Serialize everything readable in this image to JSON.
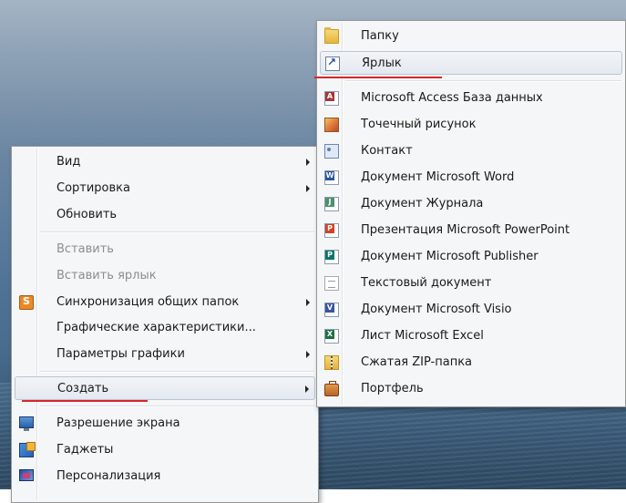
{
  "main_menu": {
    "items": [
      {
        "label": "Вид",
        "has_submenu": true,
        "disabled": false
      },
      {
        "label": "Сортировка",
        "has_submenu": true,
        "disabled": false
      },
      {
        "label": "Обновить",
        "has_submenu": false,
        "disabled": false
      },
      {
        "label": "Вставить",
        "has_submenu": false,
        "disabled": true
      },
      {
        "label": "Вставить ярлык",
        "has_submenu": false,
        "disabled": true
      },
      {
        "label": "Синхронизация общих папок",
        "has_submenu": true,
        "disabled": false,
        "icon": "sync-icon"
      },
      {
        "label": "Графические характеристики...",
        "has_submenu": false,
        "disabled": false
      },
      {
        "label": "Параметры графики",
        "has_submenu": true,
        "disabled": false
      },
      {
        "label": "Создать",
        "has_submenu": true,
        "disabled": false,
        "highlighted": true
      },
      {
        "label": "Разрешение экрана",
        "has_submenu": false,
        "disabled": false,
        "icon": "screen-resolution-icon"
      },
      {
        "label": "Гаджеты",
        "has_submenu": false,
        "disabled": false,
        "icon": "gadgets-icon"
      },
      {
        "label": "Персонализация",
        "has_submenu": false,
        "disabled": false,
        "icon": "personalization-icon"
      }
    ]
  },
  "sub_menu": {
    "items": [
      {
        "label": "Папку",
        "icon": "folder-icon"
      },
      {
        "label": "Ярлык",
        "icon": "shortcut-icon",
        "highlighted": true
      },
      {
        "label": "Microsoft Access База данных",
        "icon": "access-database-icon"
      },
      {
        "label": "Точечный рисунок",
        "icon": "bitmap-image-icon"
      },
      {
        "label": "Контакт",
        "icon": "contact-icon"
      },
      {
        "label": "Документ Microsoft Word",
        "icon": "word-document-icon"
      },
      {
        "label": "Документ Журнала",
        "icon": "journal-document-icon"
      },
      {
        "label": "Презентация Microsoft PowerPoint",
        "icon": "powerpoint-presentation-icon"
      },
      {
        "label": "Документ Microsoft Publisher",
        "icon": "publisher-document-icon"
      },
      {
        "label": "Текстовый документ",
        "icon": "text-document-icon"
      },
      {
        "label": "Документ Microsoft Visio",
        "icon": "visio-document-icon"
      },
      {
        "label": "Лист Microsoft Excel",
        "icon": "excel-sheet-icon"
      },
      {
        "label": "Сжатая ZIP-папка",
        "icon": "zip-folder-icon"
      },
      {
        "label": "Портфель",
        "icon": "briefcase-icon"
      }
    ]
  },
  "icon_letters": {
    "access": "A",
    "word": "W",
    "journal": "J",
    "powerpoint": "P",
    "publisher": "P",
    "visio": "V",
    "excel": "X"
  },
  "colors": {
    "underline_red": "#d9262b",
    "menu_background": "#f5f6f7",
    "disabled_text": "#8d8d8d"
  }
}
